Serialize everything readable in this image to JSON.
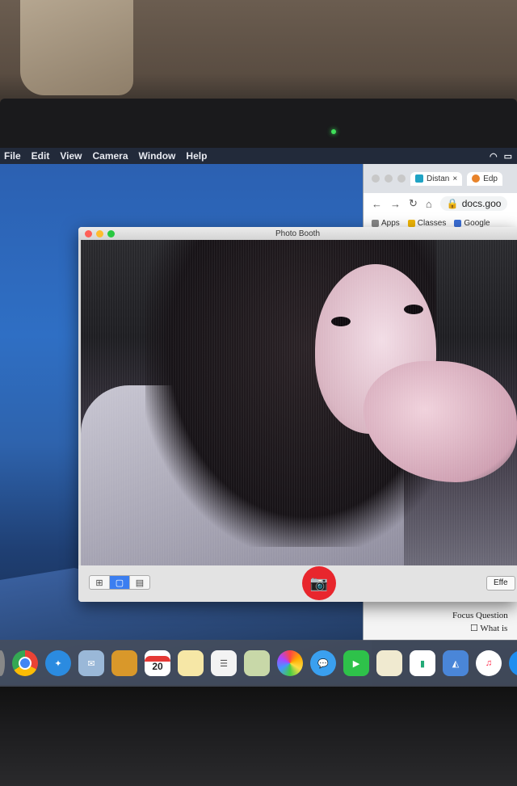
{
  "menubar": {
    "items": [
      "File",
      "Edit",
      "View",
      "Camera",
      "Window",
      "Help"
    ]
  },
  "chrome": {
    "tab1_label": "Distan",
    "tab1_close": "×",
    "tab2_label": "Edp",
    "address": "docs.goo",
    "bookmarks": [
      "Apps",
      "Classes",
      "Google"
    ],
    "doc_heading": "Focus Question",
    "doc_line": "What is"
  },
  "photobooth": {
    "title": "Photo Booth",
    "effects_label": "Effe"
  },
  "dock": {
    "calendar_day": "20"
  },
  "colors": {
    "shutter": "#e8262d",
    "mode_active": "#3b7ef0",
    "desktop": "#2f6fc4"
  }
}
